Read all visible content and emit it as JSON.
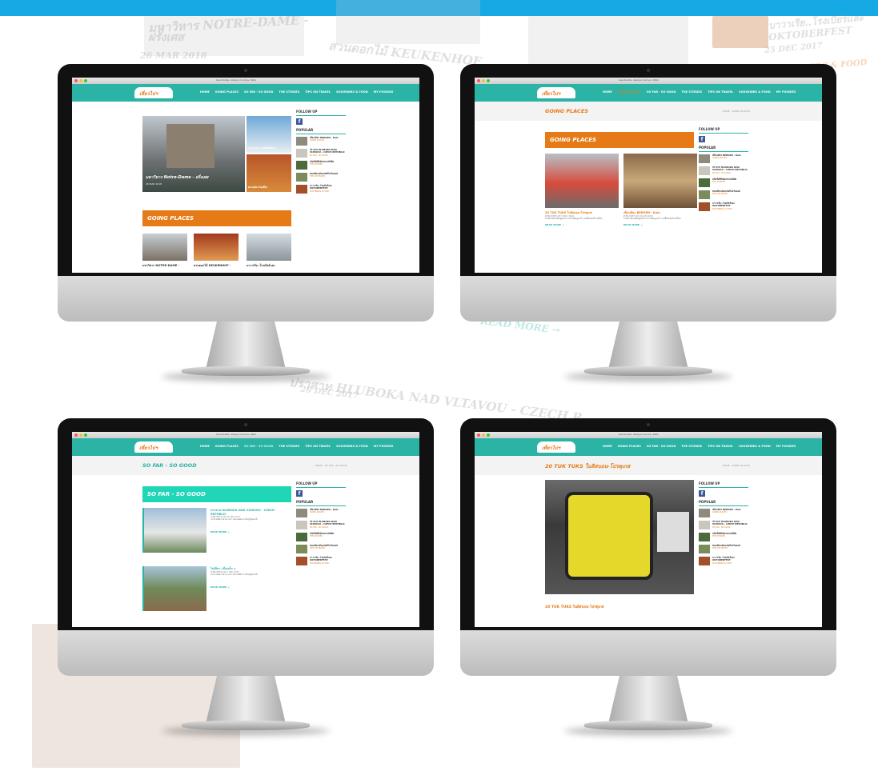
{
  "background": {
    "texts": [
      "มหาวิหาร NOTRE-DAME -",
      "ฝรั่งเศส",
      "26 MAR 2018",
      "สวนดอกไม้ KEUKENHOF",
      "บาวาเรีย..โรงเบียร์และ",
      "OKTOBERFEST",
      "25 DEC 2017",
      "SOUVENIRS & FOOD",
      "ปราสาท HLUBOKA NAD VLTAVOU - CZECH R",
      "26 DEC 2017",
      "READ MORE →"
    ],
    "accent_color": "#17a9e4"
  },
  "site": {
    "logo_text": "เที่ยวไปฯ",
    "browser_title": "Gevdouble. Always Curious. Kkkk",
    "nav": [
      "HOME",
      "GOING PLACES",
      "SO FAR - SO GOOD",
      "THE STORIES",
      "TIPS ON TRAVEL",
      "SOUVENIRS & FOOD",
      "MY FOODIES"
    ],
    "follow_up": "FOLLOW UP",
    "popular": "POPULAR",
    "popular_items": [
      {
        "title": "เที่ยวเดียว BERGEN - Kuls",
        "date": "26 JAN 2018",
        "cat": "GOING PLACES"
      },
      {
        "title": "ปราสาท HLUBOKA NAD VLTAVOU - CZECH REPUBLIC",
        "date": "26 DEC 2017",
        "cat": "SO FAR - SO GOOD"
      },
      {
        "title": "สกีครั้งที่ที่เมืองชามนีส์คือ",
        "date": "27 DEC 2017",
        "cat": "THE STORIES"
      },
      {
        "title": "ท่องเที่ยวเมืองเชสกีไคร์มลอฟ",
        "date": "26 DEC 2017",
        "cat": "TIPS ON TRAVEL"
      },
      {
        "title": "บาวาเรีย..โรงเบียร์และ OKTOBERFEST",
        "date": "25 DEC 2017",
        "cat": "SOUVENIRS & FOOD"
      }
    ],
    "read_more": "READ MORE →"
  },
  "screens": {
    "home": {
      "featured_main": "มหาวิหาร Notre-Dame - ฝรั่งเศส",
      "featured_main_date": "26 MAR 2018",
      "featured_side_1": "Santorini ฉบับเทพนิยาย",
      "featured_side_2": "ตลาดนัด ก๊วยเตี๋ยว",
      "banner": "GOING PLACES",
      "cards": [
        "มหาวิหาร NOTRE-DAME -",
        "สวนดอกไม้ KEUKENHOF -",
        "บาวาเรีย..โรงเบียร์และ"
      ]
    },
    "going_places": {
      "title": "GOING PLACES",
      "breadcrumb": "HOME · GOING PLACES",
      "banner": "GOING PLACES",
      "card1_title": "20 TUK TUKS ในลิสบอน-โปรตุเกส",
      "card1_meta": "PUBLISHED ON 5 NOV 2016",
      "card2_title": "เที่ยวเดียว BERGEN - Kuls",
      "card2_meta": "PUBLISHED ON 26 JAN 2018",
      "excerpt": "ไปเที่ยวเมืองที่ฟังดูแล้วอาจจะไม่คุ้นหูเท่าไร แต่ก็มีเสน่ห์ไม่แพ้ใคร"
    },
    "so_far": {
      "title": "SO FAR - SO GOOD",
      "breadcrumb": "HOME · SO FAR - SO GOOD",
      "banner": "SO FAR - SO GOOD",
      "post1_title": "ปราสาท HLUBOKA NAD VLTAVOU - CZECH REPUBLIC",
      "post1_meta": "PUBLISHED ON 26 DEC 2017",
      "post2_title": "ไปเที่ยว..เมืองเล็ก ๆ",
      "post2_meta": "PUBLISHED ON 1 DEC 2016",
      "excerpt": "ปราสาทสีขาวสวยงามราวกับเทพนิยาย ตั้งอยู่ริมแม่น้ำ"
    },
    "tuk": {
      "title": "20 TUK TUKS ในลิสบอน-โปรตุเกส",
      "breadcrumb": "HOME · GOING PLACES",
      "caption": "20 TUK TUKS ในลิสบอน-โปรตุเกส"
    }
  }
}
